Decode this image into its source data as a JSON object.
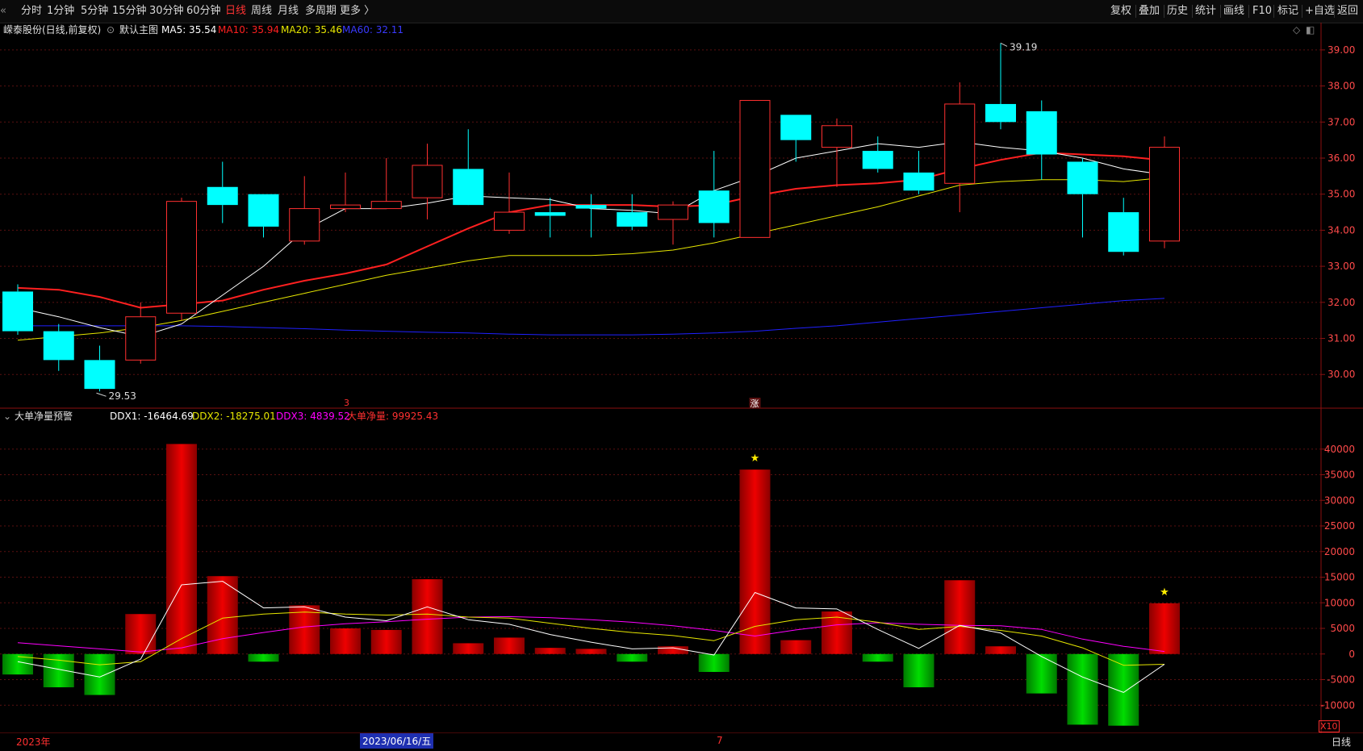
{
  "toolbar": {
    "periods": [
      "分时",
      "1分钟",
      "5分钟",
      "15分钟",
      "30分钟",
      "60分钟",
      "日线",
      "周线",
      "月线",
      "多周期",
      "更多 〉"
    ],
    "active_period": "日线",
    "right_buttons": [
      "复权",
      "叠加",
      "历史",
      "统计",
      "画线",
      "F10",
      "标记",
      "+自选",
      "返回"
    ]
  },
  "main_legend": {
    "stock": "嵘泰股份(日线,前复权)",
    "template": "默认主图",
    "ma5": "MA5: 35.54",
    "ma10": "MA10: 35.94",
    "ma20": "MA20: 35.46",
    "ma60": "MA60: 32.11"
  },
  "sub_legend": {
    "indicator": "大单净量预警",
    "ddx1": "DDX1: -16464.69",
    "ddx2": "DDX2: -18275.01",
    "ddx3": "DDX3: 4839.52",
    "net": "大单净量: 99925.43"
  },
  "annotations": {
    "high": "39.19",
    "low": "29.53",
    "marker_a": "3",
    "marker_b": "涨",
    "star": "★"
  },
  "bottom": {
    "year": "2023年",
    "cursor_date": "2023/06/16/五",
    "month": "7",
    "period_label": "日线",
    "scale": "X10"
  },
  "colors": {
    "up": "#ff3030",
    "down": "#00ffff",
    "ma5": "#ffffff",
    "ma10": "#ff2020",
    "ma20": "#e6e600",
    "ma60": "#2020ff",
    "ddx1": "#ffffff",
    "ddx2": "#e6e600",
    "ddx3": "#ff00ff",
    "bar_up": "#ee0000",
    "bar_down": "#00dd00"
  },
  "chart_data": [
    {
      "type": "candlestick",
      "ylim": [
        29.2,
        39.4
      ],
      "yticks": [
        "30.00",
        "31.00",
        "32.00",
        "33.00",
        "34.00",
        "35.00",
        "36.00",
        "37.00",
        "38.00",
        "39.00"
      ],
      "candles": [
        {
          "o": 32.3,
          "h": 32.5,
          "l": 31.1,
          "c": 31.2
        },
        {
          "o": 31.2,
          "h": 31.4,
          "l": 30.1,
          "c": 30.4
        },
        {
          "o": 30.4,
          "h": 30.8,
          "l": 29.53,
          "c": 29.6
        },
        {
          "o": 30.4,
          "h": 32.0,
          "l": 30.3,
          "c": 31.6
        },
        {
          "o": 31.7,
          "h": 34.9,
          "l": 31.5,
          "c": 34.8
        },
        {
          "o": 35.2,
          "h": 35.9,
          "l": 34.2,
          "c": 34.7
        },
        {
          "o": 35.0,
          "h": 35.0,
          "l": 33.8,
          "c": 34.1
        },
        {
          "o": 33.7,
          "h": 35.5,
          "l": 33.6,
          "c": 34.6
        },
        {
          "o": 34.6,
          "h": 35.6,
          "l": 34.5,
          "c": 34.7
        },
        {
          "o": 34.6,
          "h": 36.0,
          "l": 34.6,
          "c": 34.8
        },
        {
          "o": 34.9,
          "h": 36.4,
          "l": 34.3,
          "c": 35.8
        },
        {
          "o": 35.7,
          "h": 36.8,
          "l": 34.8,
          "c": 34.7
        },
        {
          "o": 34.0,
          "h": 35.6,
          "l": 33.9,
          "c": 34.5
        },
        {
          "o": 34.5,
          "h": 34.9,
          "l": 33.8,
          "c": 34.4
        },
        {
          "o": 34.7,
          "h": 35.0,
          "l": 33.8,
          "c": 34.6
        },
        {
          "o": 34.5,
          "h": 35.0,
          "l": 34.0,
          "c": 34.1
        },
        {
          "o": 34.3,
          "h": 34.8,
          "l": 33.6,
          "c": 34.7
        },
        {
          "o": 35.1,
          "h": 36.2,
          "l": 33.8,
          "c": 34.2
        },
        {
          "o": 33.8,
          "h": 37.6,
          "l": 33.8,
          "c": 37.6
        },
        {
          "o": 37.2,
          "h": 37.2,
          "l": 35.9,
          "c": 36.5
        },
        {
          "o": 36.3,
          "h": 37.1,
          "l": 35.2,
          "c": 36.9
        },
        {
          "o": 36.2,
          "h": 36.6,
          "l": 35.6,
          "c": 35.7
        },
        {
          "o": 35.6,
          "h": 36.2,
          "l": 35.0,
          "c": 35.1
        },
        {
          "o": 35.3,
          "h": 38.1,
          "l": 34.5,
          "c": 37.5
        },
        {
          "o": 37.5,
          "h": 39.19,
          "l": 36.8,
          "c": 37.0
        },
        {
          "o": 37.3,
          "h": 37.6,
          "l": 35.4,
          "c": 36.1
        },
        {
          "o": 35.9,
          "h": 36.0,
          "l": 33.8,
          "c": 35.0
        },
        {
          "o": 34.5,
          "h": 34.9,
          "l": 33.3,
          "c": 33.4
        },
        {
          "o": 33.7,
          "h": 36.6,
          "l": 33.5,
          "c": 36.3
        }
      ],
      "ma5": [
        31.85,
        31.6,
        31.3,
        31.05,
        31.4,
        32.2,
        33.0,
        34.0,
        34.6,
        34.6,
        34.75,
        34.95,
        34.9,
        34.85,
        34.6,
        34.55,
        34.45,
        35.1,
        35.5,
        36.0,
        36.2,
        36.4,
        36.3,
        36.45,
        36.3,
        36.2,
        36.0,
        35.7,
        35.54
      ],
      "ma10": [
        32.4,
        32.35,
        32.15,
        31.85,
        31.95,
        32.05,
        32.35,
        32.6,
        32.8,
        33.05,
        33.55,
        34.05,
        34.5,
        34.7,
        34.7,
        34.7,
        34.65,
        34.7,
        34.95,
        35.15,
        35.25,
        35.3,
        35.4,
        35.7,
        35.95,
        36.15,
        36.1,
        36.05,
        35.94
      ],
      "ma20": [
        30.95,
        31.05,
        31.15,
        31.3,
        31.5,
        31.75,
        32.0,
        32.25,
        32.5,
        32.75,
        32.95,
        33.15,
        33.3,
        33.3,
        33.3,
        33.35,
        33.45,
        33.65,
        33.9,
        34.15,
        34.4,
        34.65,
        34.95,
        35.25,
        35.35,
        35.4,
        35.4,
        35.35,
        35.46
      ],
      "ma60": [
        31.35,
        31.35,
        31.35,
        31.35,
        31.35,
        31.33,
        31.3,
        31.27,
        31.23,
        31.2,
        31.17,
        31.15,
        31.12,
        31.1,
        31.1,
        31.1,
        31.12,
        31.15,
        31.2,
        31.28,
        31.35,
        31.45,
        31.55,
        31.65,
        31.75,
        31.85,
        31.95,
        32.05,
        32.11
      ]
    },
    {
      "type": "bar",
      "title": "大单净量预警",
      "ylim": [
        -15000,
        45000
      ],
      "yticks": [
        "-10000",
        "-5000",
        "0",
        "5000",
        "10000",
        "15000",
        "20000",
        "25000",
        "30000",
        "35000",
        "40000"
      ],
      "net": [
        -4000,
        -6500,
        -8000,
        7800,
        41000,
        15200,
        -1500,
        9500,
        5000,
        4700,
        14600,
        2100,
        3200,
        1200,
        1000,
        -1500,
        1500,
        -3500,
        36000,
        2700,
        8300,
        -1500,
        -6500,
        14400,
        1500,
        -7700,
        -13800,
        -14000,
        9900
      ],
      "ddx1": [
        -1500,
        -3000,
        -4500,
        -1000,
        13500,
        14200,
        9000,
        9200,
        7200,
        6500,
        9200,
        6700,
        5800,
        3800,
        2300,
        1000,
        1200,
        -200,
        12000,
        9000,
        8800,
        4800,
        1100,
        5600,
        4100,
        -500,
        -4500,
        -7500,
        -2000
      ],
      "ddx2": [
        -500,
        -1200,
        -2100,
        -1500,
        3000,
        7000,
        7800,
        8200,
        7800,
        7600,
        7800,
        7200,
        7000,
        6000,
        5000,
        4200,
        3600,
        2600,
        5400,
        6700,
        7200,
        6200,
        4800,
        5400,
        4600,
        3500,
        1200,
        -2200,
        -2000
      ],
      "ddx3": [
        2200,
        1600,
        1000,
        400,
        1200,
        3000,
        4200,
        5300,
        5900,
        6300,
        6800,
        7200,
        7300,
        7100,
        6700,
        6200,
        5500,
        4600,
        3500,
        4700,
        5700,
        6100,
        5800,
        5600,
        5500,
        4800,
        2900,
        1500,
        500
      ],
      "stars": [
        18,
        28
      ]
    }
  ]
}
